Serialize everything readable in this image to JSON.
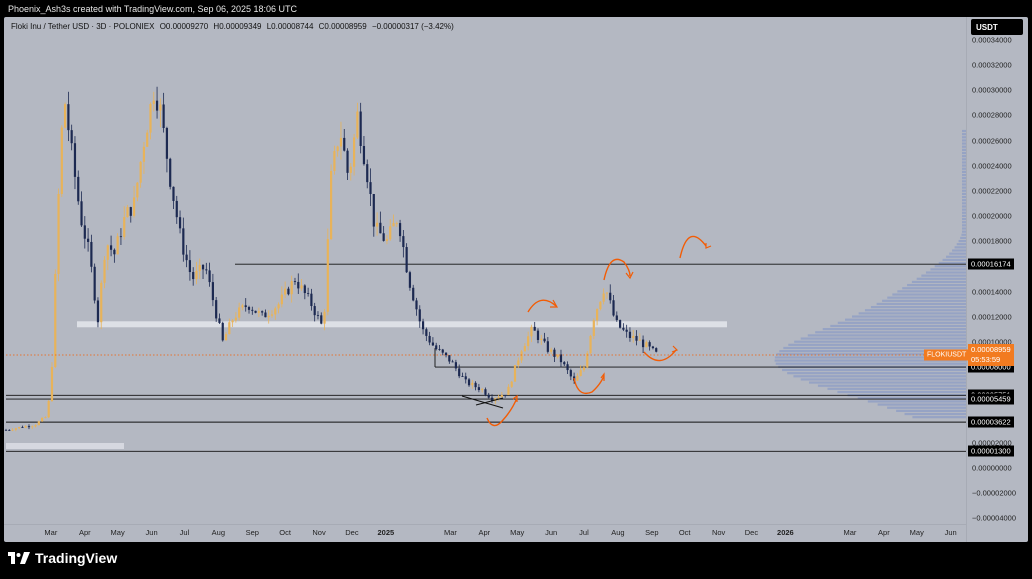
{
  "header": {
    "attribution": "Phoenix_Ash3s created with TradingView.com, Sep 06, 2025 18:06 UTC"
  },
  "legend": {
    "title": "Floki Inu / Tether USD · 3D · POLONIEX",
    "open": "O0.00009270",
    "high": "H0.00009349",
    "low": "L0.00008744",
    "close": "C0.00008959",
    "change": "−0.00000317 (−3.42%)"
  },
  "currency_button": "USDT",
  "price_axis": [
    "0.00034000",
    "0.00032000",
    "0.00030000",
    "0.00028000",
    "0.00026000",
    "0.00024000",
    "0.00022000",
    "0.00020000",
    "0.00018000",
    "0.00014000",
    "0.00012000",
    "0.00010000",
    "0.00002000",
    "0.00000000",
    "−0.00002000",
    "−0.00004000"
  ],
  "price_tags": [
    {
      "label": "0.00016174",
      "value": 0.00016174
    },
    {
      "label": "0.00008000",
      "value": 8e-05
    },
    {
      "label": "0.00005751",
      "value": 5.751e-05
    },
    {
      "label": "0.00005459",
      "value": 5.459e-05
    },
    {
      "label": "0.00003622",
      "value": 3.622e-05
    },
    {
      "label": "0.00001300",
      "value": 1.3e-05
    }
  ],
  "current_price": {
    "symbol": "FLOKIUSDT",
    "price": "0.00008959",
    "countdown": "05:53:59",
    "value": 8.959e-05
  },
  "time_axis": [
    {
      "label": "Mar",
      "bold": false
    },
    {
      "label": "Apr",
      "bold": false
    },
    {
      "label": "May",
      "bold": false
    },
    {
      "label": "Jun",
      "bold": false
    },
    {
      "label": "Jul",
      "bold": false
    },
    {
      "label": "Aug",
      "bold": false
    },
    {
      "label": "Sep",
      "bold": false
    },
    {
      "label": "Oct",
      "bold": false
    },
    {
      "label": "Nov",
      "bold": false
    },
    {
      "label": "Dec",
      "bold": false
    },
    {
      "label": "2025",
      "bold": true
    },
    {
      "label": "Mar",
      "bold": false
    },
    {
      "label": "Apr",
      "bold": false
    },
    {
      "label": "May",
      "bold": false
    },
    {
      "label": "Jun",
      "bold": false
    },
    {
      "label": "Jul",
      "bold": false
    },
    {
      "label": "Aug",
      "bold": false
    },
    {
      "label": "Sep",
      "bold": false
    },
    {
      "label": "Oct",
      "bold": false
    },
    {
      "label": "Nov",
      "bold": false
    },
    {
      "label": "Dec",
      "bold": false
    },
    {
      "label": "2026",
      "bold": true
    },
    {
      "label": "Mar",
      "bold": false
    },
    {
      "label": "Apr",
      "bold": false
    },
    {
      "label": "May",
      "bold": false
    },
    {
      "label": "Jun",
      "bold": false
    }
  ],
  "footer_brand": "TradingView",
  "chart_data": {
    "type": "candlestick",
    "title": "Floki Inu / Tether USD · 3D · POLONIEX",
    "xlabel": "",
    "ylabel": "",
    "ylim": [
      -4e-05,
      0.00034
    ],
    "x_range": [
      "2024-01-20",
      "2026-06-15"
    ],
    "grid": false,
    "colors": {
      "up": "#e8b35a",
      "down": "#1c2951",
      "marker": "#f25c05",
      "highlight": "#e4e6ec",
      "volume_profile": "#7d92c6"
    },
    "price_path": [
      [
        "2024-01-20",
        3e-05
      ],
      [
        "2024-02-01",
        3.2e-05
      ],
      [
        "2024-02-15",
        3.4e-05
      ],
      [
        "2024-02-25",
        4e-05
      ],
      [
        "2024-03-01",
        6e-05
      ],
      [
        "2024-03-05",
        0.00015
      ],
      [
        "2024-03-10",
        0.00026
      ],
      [
        "2024-03-14",
        0.00029
      ],
      [
        "2024-03-20",
        0.00025
      ],
      [
        "2024-03-28",
        0.0002
      ],
      [
        "2024-04-05",
        0.00017
      ],
      [
        "2024-04-13",
        0.000118
      ],
      [
        "2024-04-20",
        0.00018
      ],
      [
        "2024-04-28",
        0.00017
      ],
      [
        "2024-05-08",
        0.0002
      ],
      [
        "2024-05-16",
        0.00021
      ],
      [
        "2024-05-25",
        0.00026
      ],
      [
        "2024-06-03",
        0.0003
      ],
      [
        "2024-06-08",
        0.00029
      ],
      [
        "2024-06-18",
        0.00023
      ],
      [
        "2024-06-28",
        0.00018
      ],
      [
        "2024-07-08",
        0.00015
      ],
      [
        "2024-07-20",
        0.00016
      ],
      [
        "2024-08-05",
        0.0001
      ],
      [
        "2024-08-15",
        0.00012
      ],
      [
        "2024-08-28",
        0.00013
      ],
      [
        "2024-09-10",
        0.00012
      ],
      [
        "2024-09-25",
        0.00013
      ],
      [
        "2024-10-10",
        0.00015
      ],
      [
        "2024-10-25",
        0.00013
      ],
      [
        "2024-11-05",
        0.00011
      ],
      [
        "2024-11-12",
        0.00023
      ],
      [
        "2024-11-20",
        0.00027
      ],
      [
        "2024-11-28",
        0.00023
      ],
      [
        "2024-12-06",
        0.00028
      ],
      [
        "2024-12-14",
        0.00024
      ],
      [
        "2024-12-22",
        0.00019
      ],
      [
        "2025-01-02",
        0.00018
      ],
      [
        "2025-01-12",
        0.0002
      ],
      [
        "2025-01-22",
        0.00015
      ],
      [
        "2025-02-03",
        0.00011
      ],
      [
        "2025-02-15",
        9.5e-05
      ],
      [
        "2025-03-01",
        8.5e-05
      ],
      [
        "2025-03-15",
        6.8e-05
      ],
      [
        "2025-03-30",
        6.2e-05
      ],
      [
        "2025-04-08",
        5.5e-05
      ],
      [
        "2025-04-22",
        6e-05
      ],
      [
        "2025-05-05",
        9.5e-05
      ],
      [
        "2025-05-15",
        0.00011
      ],
      [
        "2025-05-28",
        9.5e-05
      ],
      [
        "2025-06-10",
        8.5e-05
      ],
      [
        "2025-06-22",
        6.8e-05
      ],
      [
        "2025-07-01",
        8e-05
      ],
      [
        "2025-07-10",
        0.00012
      ],
      [
        "2025-07-20",
        0.000145
      ],
      [
        "2025-07-30",
        0.000115
      ],
      [
        "2025-08-10",
        0.000105
      ],
      [
        "2025-08-22",
        0.0001
      ],
      [
        "2025-09-06",
        8.959e-05
      ]
    ],
    "horizontal_levels": [
      0.00016174,
      8e-05,
      5.751e-05,
      5.459e-05,
      3.622e-05,
      1.3e-05
    ],
    "support_zone": {
      "from": "2024-03-10",
      "to": "2025-10-30",
      "value": 0.000114
    }
  }
}
